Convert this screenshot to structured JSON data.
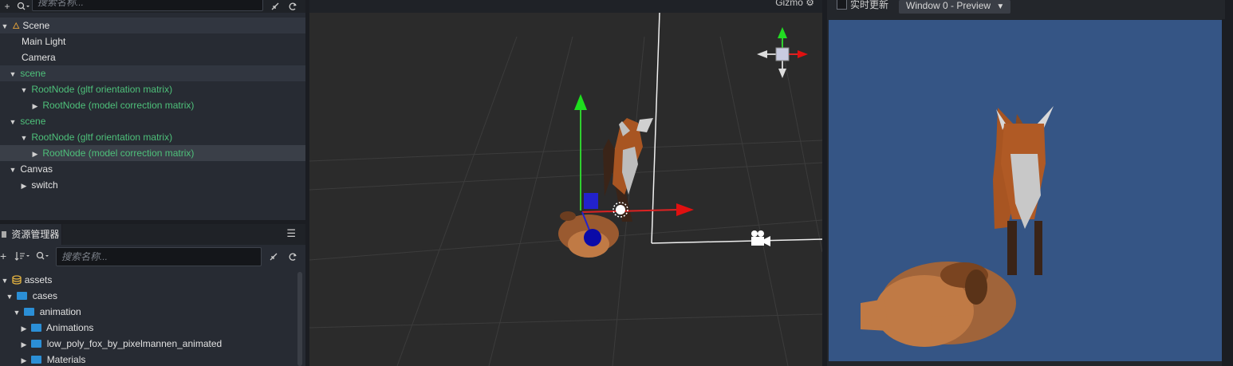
{
  "hierarchy": {
    "search_placeholder": "搜索名称...",
    "nodes": [
      {
        "label": "Scene",
        "arrow": "▼",
        "icon": "fire-icon"
      },
      {
        "label": "Main Light",
        "arrow": ""
      },
      {
        "label": "Camera",
        "arrow": ""
      },
      {
        "label": "scene",
        "arrow": "▼"
      },
      {
        "label": "RootNode (gltf orientation matrix)",
        "arrow": "▼"
      },
      {
        "label": "RootNode (model correction matrix)",
        "arrow": "▶"
      },
      {
        "label": "scene",
        "arrow": "▼"
      },
      {
        "label": "RootNode (gltf orientation matrix)",
        "arrow": "▼"
      },
      {
        "label": "RootNode (model correction matrix)",
        "arrow": "▶"
      },
      {
        "label": "Canvas",
        "arrow": "▼"
      },
      {
        "label": "switch",
        "arrow": "▶"
      }
    ]
  },
  "assets": {
    "tab_label": "资源管理器",
    "menu_icon": "☰",
    "search_placeholder": "搜索名称...",
    "items": [
      {
        "label": "assets",
        "arrow": "▼",
        "icon": "database-icon"
      },
      {
        "label": "cases",
        "arrow": "▼",
        "icon": "folder-icon"
      },
      {
        "label": "animation",
        "arrow": "▼",
        "icon": "folder-icon"
      },
      {
        "label": "Animations",
        "arrow": "▶",
        "icon": "folder-icon"
      },
      {
        "label": "low_poly_fox_by_pixelmannen_animated",
        "arrow": "▶",
        "icon": "folder-icon"
      },
      {
        "label": "Materials",
        "arrow": "▶",
        "icon": "folder-icon"
      }
    ]
  },
  "scene_view": {
    "gizmo_label": "Gizmo",
    "gizmo_icon": "⚙"
  },
  "preview": {
    "realtime_label": "实时更新",
    "window_select": "Window 0 - Preview",
    "bg_color": "#355585"
  },
  "colors": {
    "green_node": "#4ec07a",
    "panel_bg": "#272b33",
    "folder": "#2b8fd6"
  }
}
